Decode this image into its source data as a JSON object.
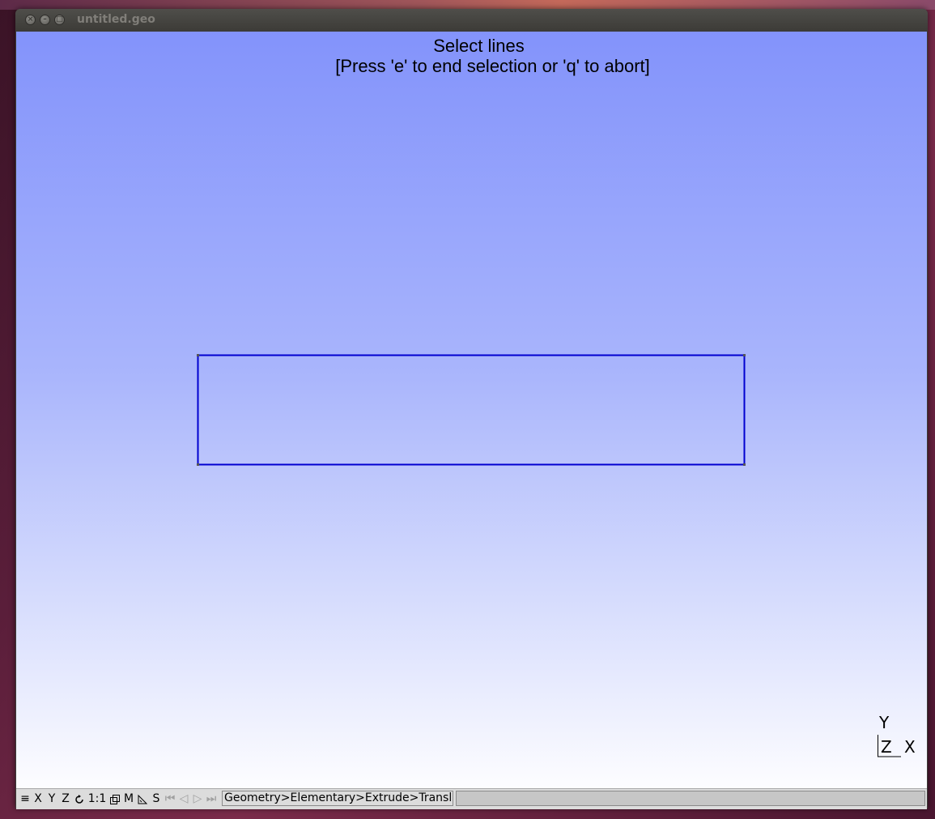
{
  "window": {
    "title": "untitled.geo",
    "close_glyph": "×",
    "minimize_glyph": "–",
    "maximize_glyph": "□"
  },
  "graphic": {
    "message_line1": "Select lines",
    "message_line2": "[Press 'e' to end selection or 'q' to abort]",
    "line_color": "#0000d0",
    "point_color": "#555555",
    "axes": {
      "y": "Y",
      "z": "Z",
      "x": "X"
    }
  },
  "statusbar": {
    "menu_icon": "≡",
    "x_label": "X",
    "y_label": "Y",
    "z_label": "Z",
    "rotate_icon": "rotate-icon",
    "scale_label": "1:1",
    "projection_icon": "projection-icon",
    "mesh_label": "M",
    "ruler_icon": "ruler-icon",
    "s_label": "S",
    "first_icon": "⏮",
    "prev_icon": "◁",
    "play_icon": "▷",
    "last_icon": "⏭",
    "message": "Geometry>Elementary>Extrude>Translate>Line"
  }
}
